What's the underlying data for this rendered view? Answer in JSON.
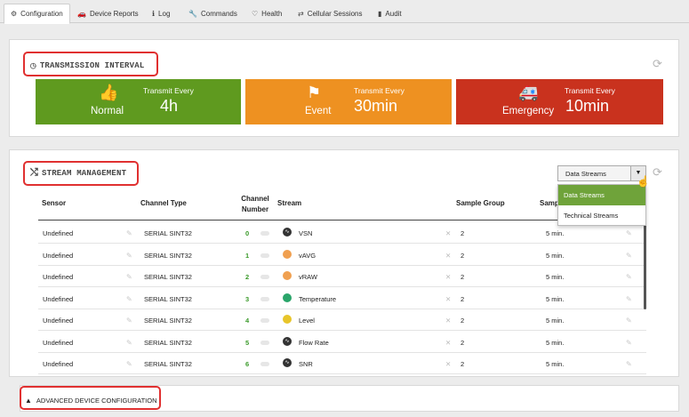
{
  "tabs": [
    {
      "label": "Configuration",
      "icon": "gears-icon",
      "active": true
    },
    {
      "label": "Device Reports",
      "icon": "car-icon"
    },
    {
      "label": "Log",
      "icon": "info-icon"
    },
    {
      "label": "Commands",
      "icon": "wrench-icon"
    },
    {
      "label": "Health",
      "icon": "stethoscope-icon"
    },
    {
      "label": "Cellular Sessions",
      "icon": "arrows-icon"
    },
    {
      "label": "Audit",
      "icon": "book-icon"
    }
  ],
  "transmission": {
    "title": "TRANSMISSION INTERVAL",
    "boxes": [
      {
        "label": "Normal",
        "caption": "Transmit Every",
        "value": "4h",
        "color": "#5f9a1f",
        "icon": "thumbs-up-icon"
      },
      {
        "label": "Event",
        "caption": "Transmit Every",
        "value": "30min",
        "color": "#ee9121",
        "icon": "flag-icon"
      },
      {
        "label": "Emergency",
        "caption": "Transmit Every",
        "value": "10min",
        "color": "#c9321e",
        "icon": "ambulance-icon"
      }
    ]
  },
  "streams": {
    "title": "STREAM MANAGEMENT",
    "dropdown": {
      "selected": "Data Streams",
      "options": [
        "Data Streams",
        "Technical Streams"
      ]
    },
    "columns": {
      "sensor": "Sensor",
      "channel_type": "Channel Type",
      "channel_number": "Channel Number",
      "stream": "Stream",
      "sample_group": "Sample Group",
      "sample_rate": "Samp"
    },
    "rows": [
      {
        "sensor": "Undefined",
        "channel_type": "SERIAL SINT32",
        "channel": "0",
        "stream": "VSN",
        "dot_color": "#333333",
        "group": "2",
        "rate": "5 min."
      },
      {
        "sensor": "Undefined",
        "channel_type": "SERIAL SINT32",
        "channel": "1",
        "stream": "vAVG",
        "dot_color": "#f0a050",
        "group": "2",
        "rate": "5 min."
      },
      {
        "sensor": "Undefined",
        "channel_type": "SERIAL SINT32",
        "channel": "2",
        "stream": "vRAW",
        "dot_color": "#f0a050",
        "group": "2",
        "rate": "5 min."
      },
      {
        "sensor": "Undefined",
        "channel_type": "SERIAL SINT32",
        "channel": "3",
        "stream": "Temperature",
        "dot_color": "#2aa56a",
        "group": "2",
        "rate": "5 min."
      },
      {
        "sensor": "Undefined",
        "channel_type": "SERIAL SINT32",
        "channel": "4",
        "stream": "Level",
        "dot_color": "#e8c52a",
        "group": "2",
        "rate": "5 min."
      },
      {
        "sensor": "Undefined",
        "channel_type": "SERIAL SINT32",
        "channel": "5",
        "stream": "Flow Rate",
        "dot_color": "#333333",
        "group": "2",
        "rate": "5 min."
      },
      {
        "sensor": "Undefined",
        "channel_type": "SERIAL SINT32",
        "channel": "6",
        "stream": "SNR",
        "dot_color": "#333333",
        "group": "2",
        "rate": "5 min."
      }
    ]
  },
  "advanced": {
    "title": "ADVANCED DEVICE CONFIGURATION"
  }
}
